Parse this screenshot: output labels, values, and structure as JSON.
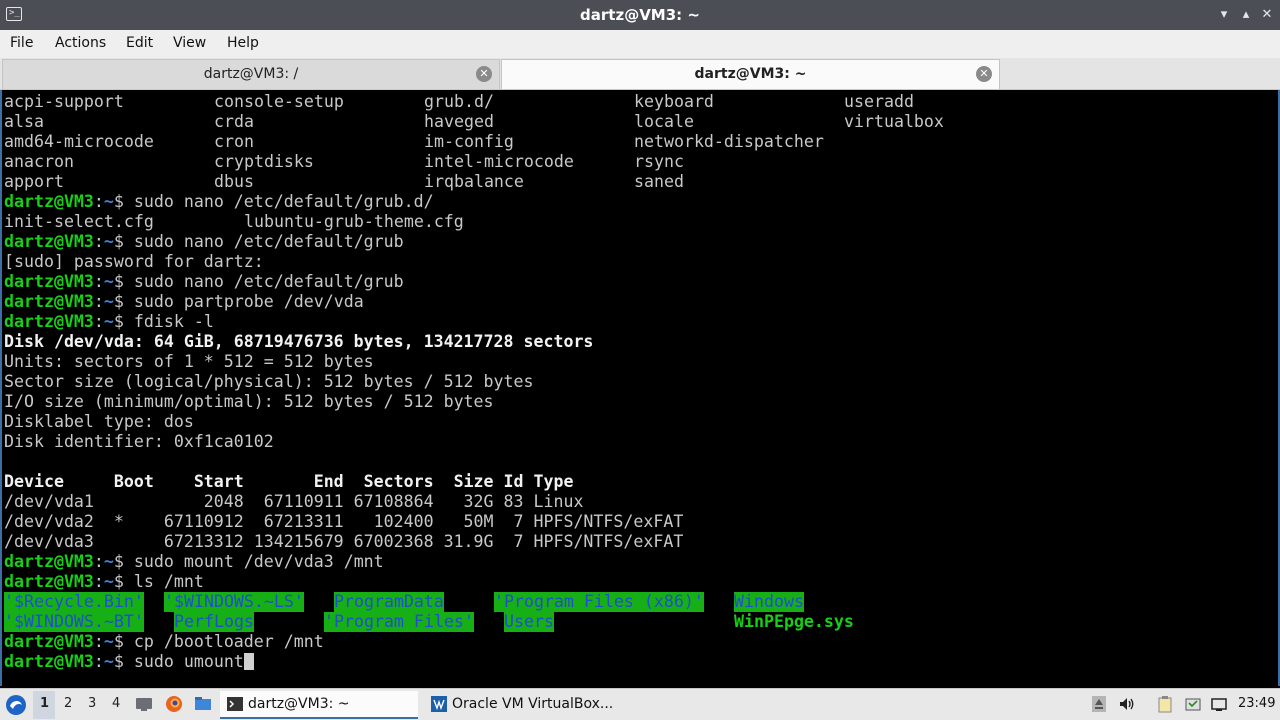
{
  "window": {
    "title": "dartz@VM3: ~",
    "app_icon_glyph": ">_",
    "minimize": "▾",
    "maximize": "▴",
    "close": "✕"
  },
  "menu": {
    "file": "File",
    "actions": "Actions",
    "edit": "Edit",
    "view": "View",
    "help": "Help"
  },
  "tabs": [
    {
      "label": "dartz@VM3: /",
      "active": false
    },
    {
      "label": "dartz@VM3: ~",
      "active": true
    }
  ],
  "tab_close_glyph": "✕",
  "terminal": {
    "prompt_user": "dartz@VM3",
    "prompt_sep": ":",
    "prompt_dir": "~",
    "prompt_dollar": "$ ",
    "etc_default_listing": [
      [
        "acpi-support",
        "console-setup",
        "grub.d/",
        "keyboard",
        "useradd"
      ],
      [
        "alsa",
        "crda",
        "haveged",
        "locale",
        "virtualbox"
      ],
      [
        "amd64-microcode",
        "cron",
        "im-config",
        "networkd-dispatcher",
        ""
      ],
      [
        "anacron",
        "cryptdisks",
        "intel-microcode",
        "rsync",
        ""
      ],
      [
        "apport",
        "dbus",
        "irqbalance",
        "saned",
        ""
      ]
    ],
    "cmd1": "sudo nano /etc/default/grub.d/",
    "grubd_files": [
      "init-select.cfg",
      "lubuntu-grub-theme.cfg"
    ],
    "cmd2": "sudo nano /etc/default/grub",
    "sudo_prompt": "[sudo] password for dartz:",
    "cmd3": "sudo nano /etc/default/grub",
    "cmd4": "sudo partprobe /dev/vda",
    "cmd5": "fdisk -l",
    "disk_header": "Disk /dev/vda: 64 GiB, 68719476736 bytes, 134217728 sectors",
    "disk_info": [
      "Units: sectors of 1 * 512 = 512 bytes",
      "Sector size (logical/physical): 512 bytes / 512 bytes",
      "I/O size (minimum/optimal): 512 bytes / 512 bytes",
      "Disklabel type: dos",
      "Disk identifier: 0xf1ca0102"
    ],
    "partition_header": "Device     Boot    Start       End  Sectors  Size Id Type",
    "partitions": [
      "/dev/vda1           2048  67110911 67108864   32G 83 Linux",
      "/dev/vda2  *    67110912  67213311   102400   50M  7 HPFS/NTFS/exFAT",
      "/dev/vda3       67213312 134215679 67002368 31.9G  7 HPFS/NTFS/exFAT"
    ],
    "cmd6": "sudo mount /dev/vda3 /mnt",
    "cmd7": "ls /mnt",
    "mnt_entries": {
      "recycle_bin": "'$Recycle.Bin'",
      "windows_ls": "'$WINDOWS.~LS'",
      "program_data": "ProgramData",
      "program_files_x86": "'Program Files (x86)'",
      "windows": "Windows",
      "windows_bt": "'$WINDOWS.~BT'",
      "perflogs": "PerfLogs",
      "program_files": "'Program Files'",
      "users": "Users",
      "winpe": "WinPEpge.sys"
    },
    "cmd8": "cp /bootloader /mnt",
    "cmd9": "sudo umount"
  },
  "taskbar": {
    "workspaces": [
      "1",
      "2",
      "3",
      "4"
    ],
    "active_workspace": "1",
    "tasks": [
      {
        "label": "dartz@VM3: ~",
        "icon": "terminal-icon",
        "active": true
      },
      {
        "label": "Oracle VM VirtualBox...",
        "icon": "virtualbox-icon",
        "active": false
      }
    ],
    "clock": "23:49"
  }
}
